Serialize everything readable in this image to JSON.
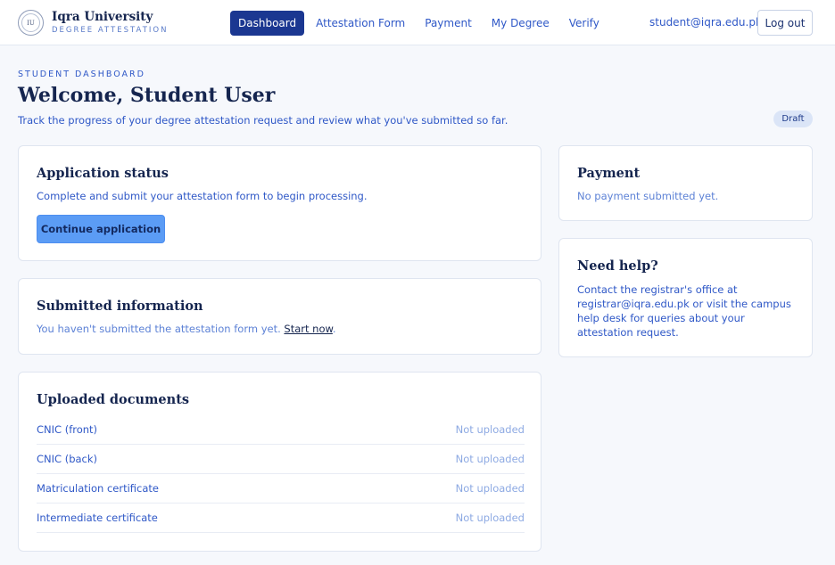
{
  "header": {
    "brand_name": "Iqra University",
    "brand_subtitle": "DEGREE ATTESTATION",
    "seal_text": "IU",
    "nav": [
      {
        "label": "Dashboard",
        "active": true
      },
      {
        "label": "Attestation Form",
        "active": false
      },
      {
        "label": "Payment",
        "active": false
      },
      {
        "label": "My Degree",
        "active": false
      },
      {
        "label": "Verify",
        "active": false
      }
    ],
    "user_email": "student@iqra.edu.pk",
    "logout_label": "Log out"
  },
  "page": {
    "eyebrow": "STUDENT DASHBOARD",
    "title": "Welcome, Student User",
    "subtitle": "Track the progress of your degree attestation request and review what you've submitted so far.",
    "status_badge": "Draft"
  },
  "application_status": {
    "title": "Application status",
    "text": "Complete and submit your attestation form to begin processing.",
    "button_label": "Continue application"
  },
  "submitted_info": {
    "title": "Submitted information",
    "text": "You haven't submitted the attestation form yet.",
    "link_label": "Start now",
    "link_suffix": "."
  },
  "documents": {
    "title": "Uploaded documents",
    "items": [
      {
        "name": "CNIC (front)",
        "status": "Not uploaded"
      },
      {
        "name": "CNIC (back)",
        "status": "Not uploaded"
      },
      {
        "name": "Matriculation certificate",
        "status": "Not uploaded"
      },
      {
        "name": "Intermediate certificate",
        "status": "Not uploaded"
      }
    ]
  },
  "payment": {
    "title": "Payment",
    "text": "No payment submitted yet."
  },
  "help": {
    "title": "Need help?",
    "text": "Contact the registrar's office at registrar@iqra.edu.pk or visit the campus help desk for queries about your attestation request."
  },
  "colors": {
    "primary": "#1b3791",
    "accent": "#2f58c7",
    "button": "#5b9cf5",
    "badge_bg": "#dbe5f7"
  }
}
